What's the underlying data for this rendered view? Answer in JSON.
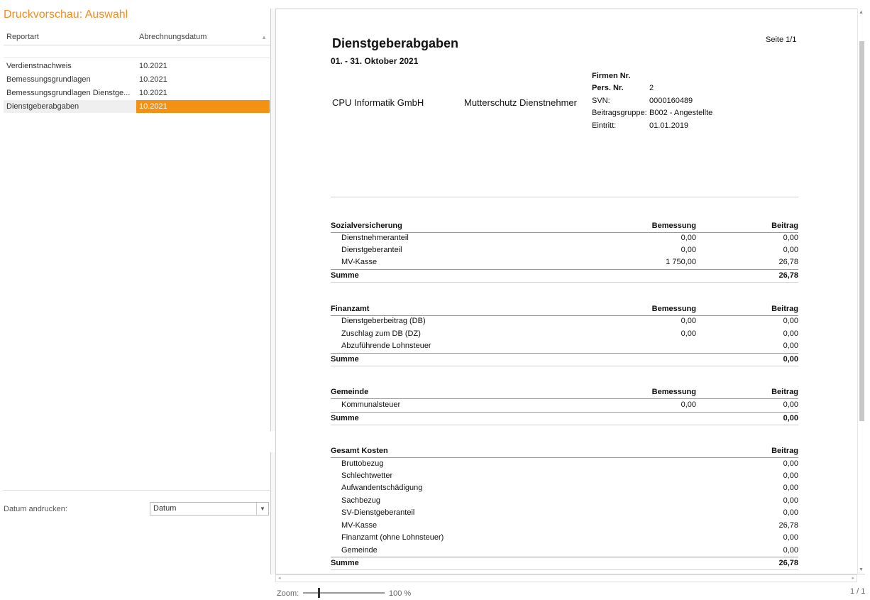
{
  "left_panel": {
    "title": "Druckvorschau: Auswahl",
    "columns": {
      "reportart": "Reportart",
      "abrechnungsdatum": "Abrechnungsdatum"
    },
    "rows": [
      {
        "reportart": "Verdienstnachweis",
        "datum": "10.2021"
      },
      {
        "reportart": "Bemessungsgrundlagen",
        "datum": "10.2021"
      },
      {
        "reportart": "Bemessungsgrundlagen Dienstge...",
        "datum": "10.2021"
      },
      {
        "reportart": "Dienstgeberabgaben",
        "datum": "10.2021"
      }
    ],
    "datum_andrucken_label": "Datum andrucken:",
    "datum_select_value": "Datum"
  },
  "report": {
    "title": "Dienstgeberabgaben",
    "period": "01. - 31. Oktober 2021",
    "page": "Seite 1/1",
    "company": "CPU Informatik GmbH",
    "employee": "Mutterschutz Dienstnehmer",
    "info": {
      "firmen_nr_label": "Firmen Nr.",
      "pers_nr_label": "Pers. Nr.",
      "pers_nr": "2",
      "svn_label": "SVN:",
      "svn": "0000160489",
      "beitragsgruppe_label": "Beitragsgruppe:",
      "beitragsgruppe": "B002 - Angestellte",
      "eintritt_label": "Eintritt:",
      "eintritt": "01.01.2019"
    },
    "col_bemessung": "Bemessung",
    "col_beitrag": "Beitrag",
    "summe_label": "Summe",
    "sozialversicherung": {
      "title": "Sozialversicherung",
      "rows": [
        {
          "label": "Dienstnehmeranteil",
          "bemessung": "0,00",
          "beitrag": "0,00"
        },
        {
          "label": "Dienstgeberanteil",
          "bemessung": "0,00",
          "beitrag": "0,00"
        },
        {
          "label": "MV-Kasse",
          "bemessung": "1 750,00",
          "beitrag": "26,78"
        }
      ],
      "summe": "26,78"
    },
    "finanzamt": {
      "title": "Finanzamt",
      "rows": [
        {
          "label": "Dienstgeberbeitrag (DB)",
          "bemessung": "0,00",
          "beitrag": "0,00"
        },
        {
          "label": "Zuschlag zum DB (DZ)",
          "bemessung": "0,00",
          "beitrag": "0,00"
        },
        {
          "label": "Abzuführende Lohnsteuer",
          "bemessung": "",
          "beitrag": "0,00"
        }
      ],
      "summe": "0,00"
    },
    "gemeinde": {
      "title": "Gemeinde",
      "rows": [
        {
          "label": "Kommunalsteuer",
          "bemessung": "0,00",
          "beitrag": "0,00"
        }
      ],
      "summe": "0,00"
    },
    "gesamt": {
      "title": "Gesamt Kosten",
      "rows": [
        {
          "label": "Bruttobezug",
          "beitrag": "0,00"
        },
        {
          "label": "Schlechtwetter",
          "beitrag": "0,00"
        },
        {
          "label": "Aufwandentschädigung",
          "beitrag": "0,00"
        },
        {
          "label": "Sachbezug",
          "beitrag": "0,00"
        },
        {
          "label": "SV-Dienstgeberanteil",
          "beitrag": "0,00"
        },
        {
          "label": "MV-Kasse",
          "beitrag": "26,78"
        },
        {
          "label": "Finanzamt (ohne Lohnsteuer)",
          "beitrag": "0,00"
        },
        {
          "label": "Gemeinde",
          "beitrag": "0,00"
        }
      ],
      "summe": "26,78"
    }
  },
  "statusbar": {
    "zoom_label": "Zoom:",
    "zoom_value": "100 %",
    "zoom_level_percent": 100,
    "page_count": "1 / 1"
  },
  "colors": {
    "accent": "#f39113",
    "title": "#f28c1e"
  }
}
